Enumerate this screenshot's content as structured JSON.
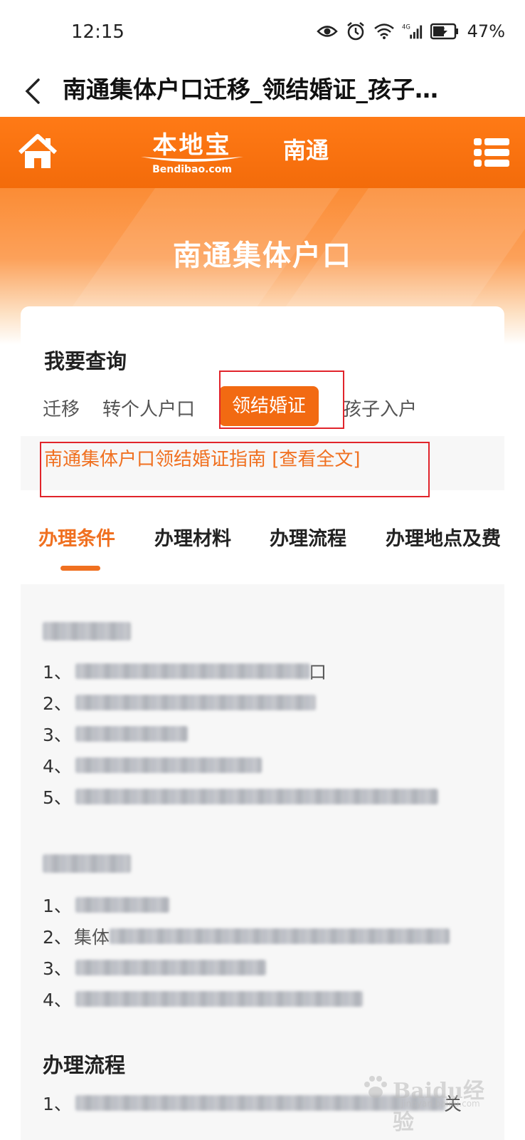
{
  "status_bar": {
    "time": "12:15",
    "battery_percent": "47%",
    "icons": [
      "eye-icon",
      "alarm-icon",
      "wifi-icon",
      "signal-4g-icon",
      "battery-icon"
    ]
  },
  "title_bar": {
    "title": "南通集体户口迁移_领结婚证_孩子…"
  },
  "site_header": {
    "logo_text": "本地宝",
    "logo_domain": "Bendibao.com",
    "city": "南通"
  },
  "banner": {
    "title": "南通集体户口"
  },
  "query": {
    "label": "我要查询",
    "tabs": [
      "迁移",
      "转个人户口",
      "领结婚证",
      "孩子入户"
    ],
    "active_tab": "领结婚证"
  },
  "guide": {
    "link_text": "南通集体户口领结婚证指南 [查看全文]"
  },
  "section_tabs": {
    "tabs": [
      "办理条件",
      "办理材料",
      "办理流程",
      "办理地点及费"
    ],
    "active_tab": "办理条件"
  },
  "content": {
    "sections": [
      {
        "items": [
          {
            "num": "1、",
            "tail": "口"
          },
          {
            "num": "2、",
            "tail": ""
          },
          {
            "num": "3、",
            "tail": ""
          },
          {
            "num": "4、",
            "tail": ""
          },
          {
            "num": "5、",
            "tail": ""
          }
        ]
      },
      {
        "items": [
          {
            "num": "1、",
            "tail": ""
          },
          {
            "num": "2、",
            "tail": "集体"
          },
          {
            "num": "3、",
            "tail": ""
          },
          {
            "num": "4、",
            "tail": ""
          }
        ]
      },
      {
        "title": "办理流程",
        "items": [
          {
            "num": "1、",
            "tail": "关"
          }
        ]
      }
    ]
  },
  "watermark": {
    "text": "Baidu经验",
    "sub": "jingyan.baidu.com"
  },
  "colors": {
    "brand_orange": "#f26a12",
    "highlight_red": "#e1242b",
    "link_orange": "#f07020"
  }
}
